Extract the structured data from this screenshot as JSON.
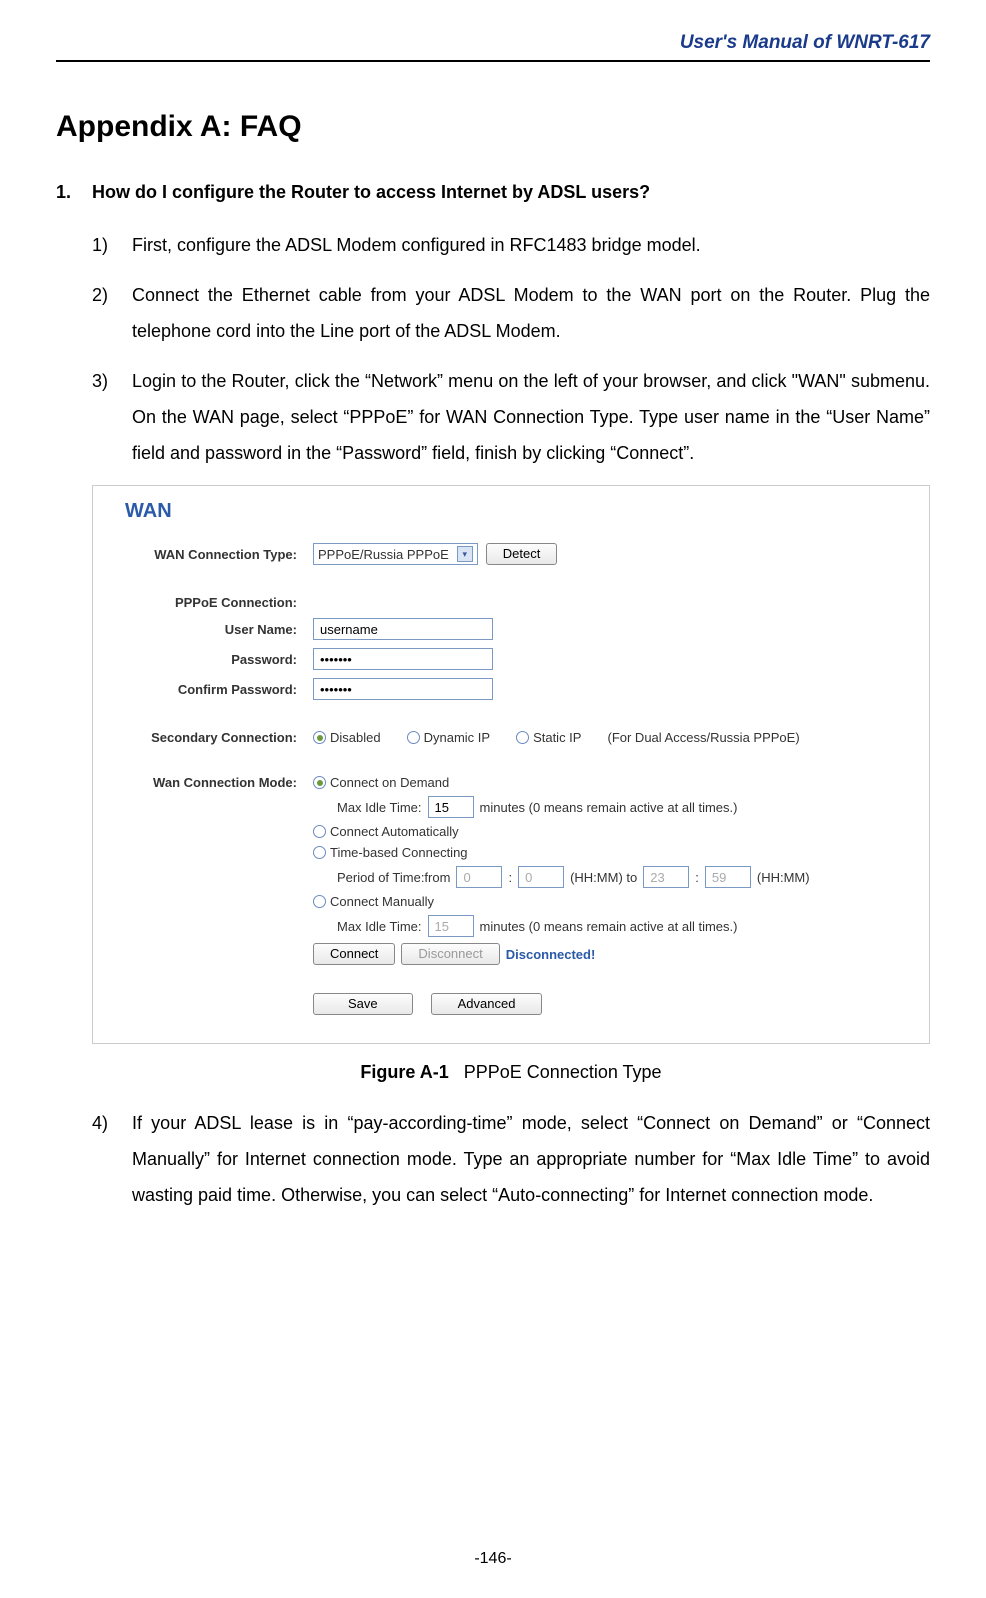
{
  "header": {
    "title": "User's Manual of WNRT-617"
  },
  "appendix": {
    "title": "Appendix A: FAQ"
  },
  "question": {
    "num": "1.",
    "text": "How do I configure the Router to access Internet by ADSL users?"
  },
  "steps": {
    "s1": {
      "num": "1)",
      "text": "First, configure the ADSL Modem configured in RFC1483 bridge model."
    },
    "s2": {
      "num": "2)",
      "text": "Connect the Ethernet cable from your ADSL Modem to the WAN port on the Router. Plug the telephone cord into the Line port of the ADSL Modem."
    },
    "s3": {
      "num": "3)",
      "text": "Login to the Router, click the “Network” menu on the left of your browser, and click \"WAN\" submenu. On the WAN page, select “PPPoE” for WAN Connection Type. Type user name in the “User Name” field and password in the “Password” field, finish by clicking “Connect”."
    },
    "s4": {
      "num": "4)",
      "text": "If your ADSL lease is in “pay-according-time” mode, select “Connect on Demand” or “Connect Manually” for Internet connection mode. Type an appropriate number for “Max Idle Time” to avoid wasting paid time. Otherwise, you can select “Auto-connecting” for Internet connection mode."
    }
  },
  "figure": {
    "label": "Figure A-1",
    "caption": "PPPoE Connection Type"
  },
  "shot": {
    "title": "WAN",
    "wct_label": "WAN Connection Type:",
    "wct_value": "PPPoE/Russia PPPoE",
    "detect": "Detect",
    "pppoe_label": "PPPoE Connection:",
    "user_label": "User Name:",
    "user_value": "username",
    "pass_label": "Password:",
    "pass_value": "•••••••",
    "confirm_label": "Confirm Password:",
    "confirm_value": "•••••••",
    "sec_label": "Secondary Connection:",
    "sec_disabled": "Disabled",
    "sec_dynamic": "Dynamic IP",
    "sec_static": "Static IP",
    "sec_note": "(For Dual Access/Russia PPPoE)",
    "mode_label": "Wan Connection Mode:",
    "mode_demand": "Connect on Demand",
    "max_idle_label": "Max Idle Time:",
    "max_idle_value": "15",
    "max_idle_unit": "minutes (0 means remain active at all times.)",
    "mode_auto": "Connect Automatically",
    "mode_time": "Time-based Connecting",
    "period_label": "Period of Time:from",
    "period_from_h": "0",
    "period_from_m": "0",
    "period_hhmm_to": "(HH:MM) to",
    "period_to_h": "23",
    "period_to_m": "59",
    "period_hhmm": "(HH:MM)",
    "mode_manual": "Connect Manually",
    "max_idle2_value": "15",
    "connect": "Connect",
    "disconnect": "Disconnect",
    "status": "Disconnected!",
    "save": "Save",
    "advanced": "Advanced"
  },
  "page": {
    "number": "-146-"
  }
}
